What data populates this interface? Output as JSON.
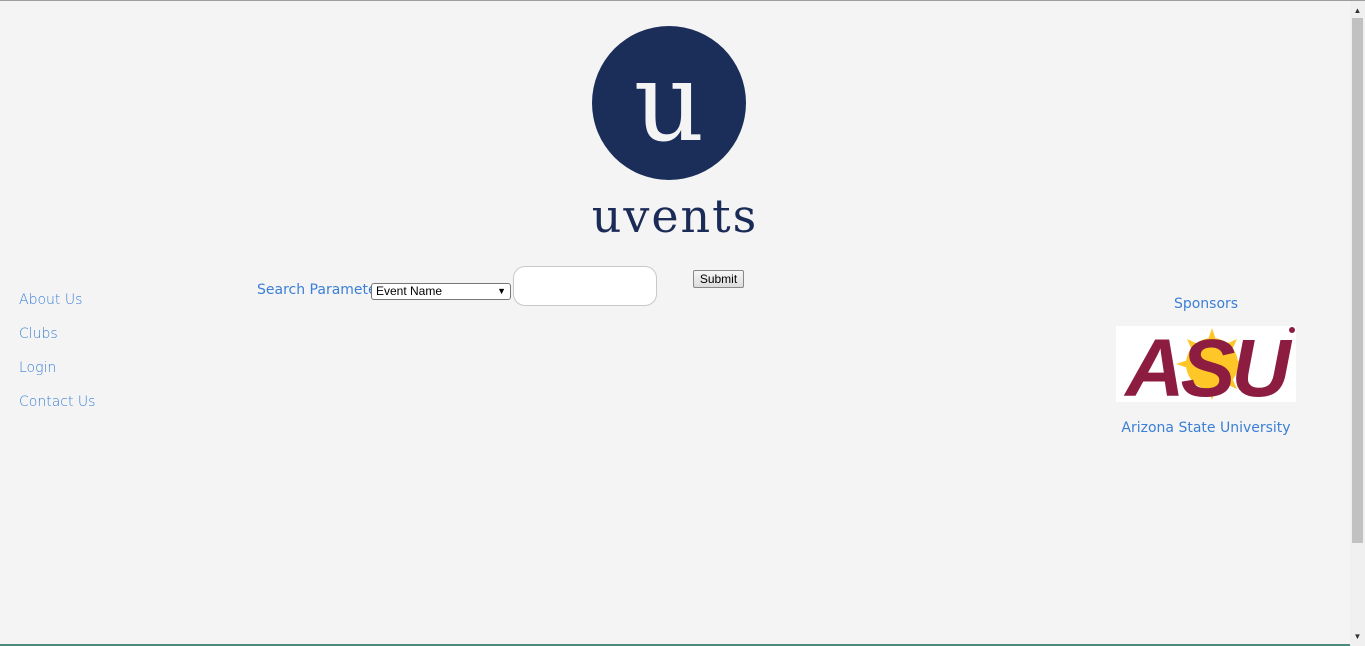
{
  "logo": {
    "letter": "u",
    "wordmark": "uvents"
  },
  "nav": {
    "items": [
      {
        "label": "About Us"
      },
      {
        "label": "Clubs"
      },
      {
        "label": "Login"
      },
      {
        "label": "Contact Us"
      }
    ]
  },
  "search": {
    "label": "Search Parameter:",
    "selected_option": "Event Name",
    "input_value": "",
    "submit_label": "Submit"
  },
  "sponsors": {
    "title": "Sponsors",
    "logo_text": "ASU",
    "name": "Arizona State University"
  },
  "colors": {
    "link": "#3b7fd6",
    "logo_navy": "#1b2b57",
    "asu_maroon": "#8c1d40",
    "asu_gold": "#ffc627",
    "background": "#f4f4f4"
  }
}
